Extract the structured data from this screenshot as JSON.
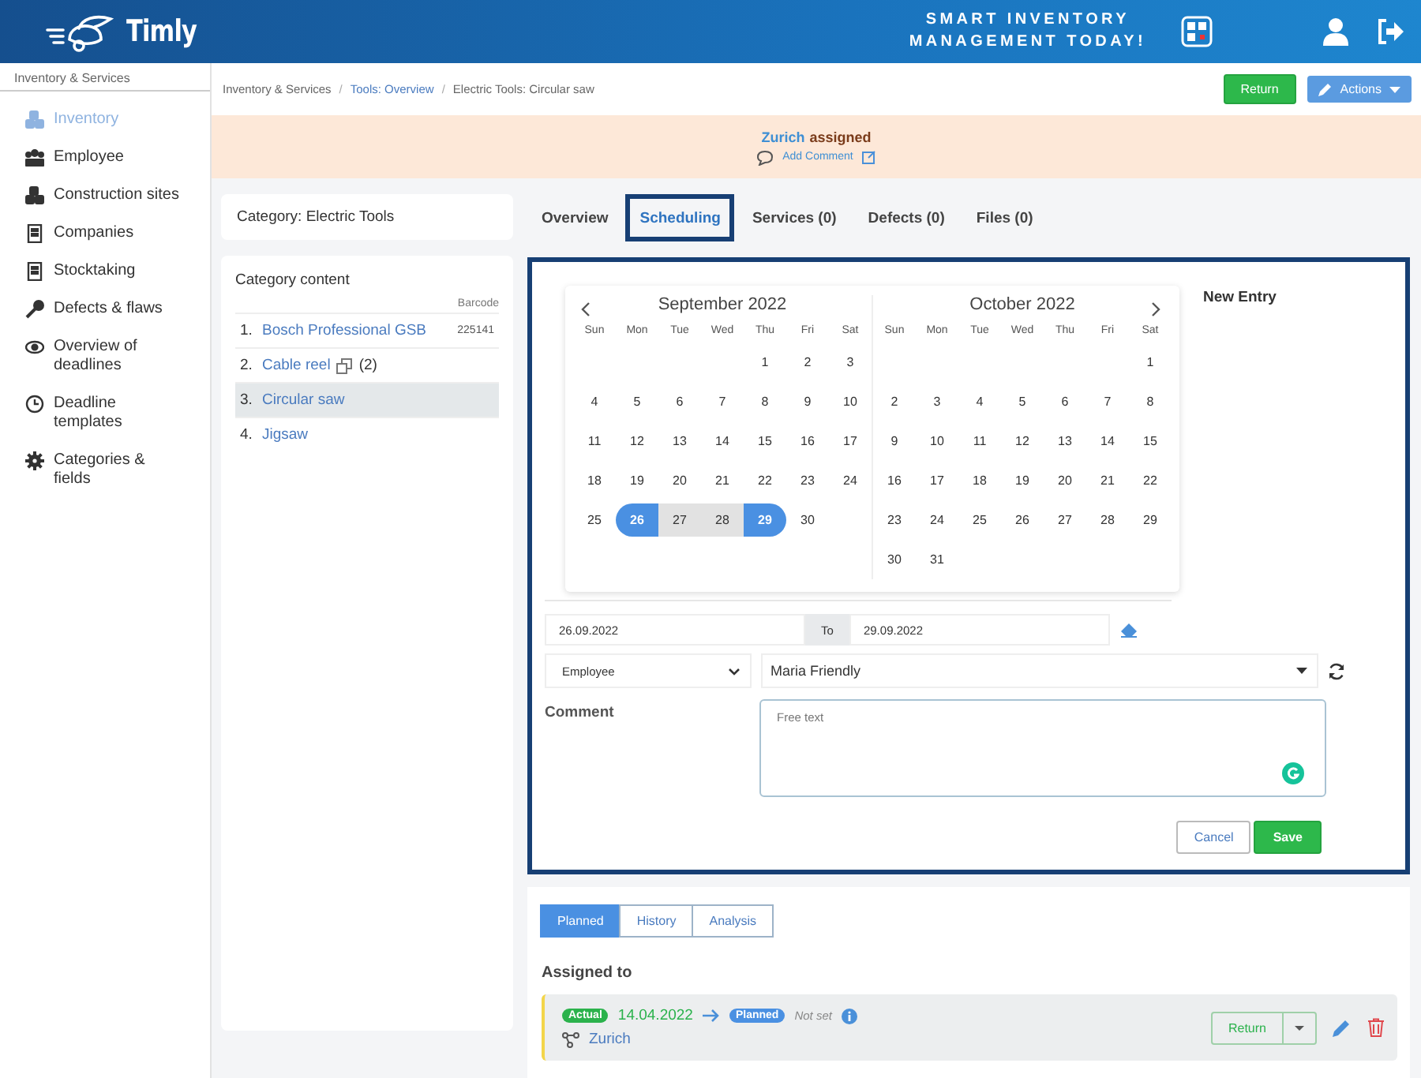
{
  "header": {
    "logo": "Timly",
    "slogan_lines": [
      "SMART INVENTORY",
      "MANAGEMENT TODAY!"
    ]
  },
  "sidebar": {
    "title": "Inventory & Services",
    "items": [
      {
        "label": "Inventory",
        "kind": "boxes",
        "selected": true
      },
      {
        "label": "Employee",
        "kind": "people",
        "selected": false
      },
      {
        "label": "Construction sites",
        "kind": "boxes",
        "selected": false
      },
      {
        "label": "Companies",
        "kind": "building",
        "selected": false
      },
      {
        "label": "Stocktaking",
        "kind": "building",
        "selected": false
      },
      {
        "label": "Defects & flaws",
        "kind": "wrench",
        "selected": false
      },
      {
        "label": "Overview of deadlines",
        "kind": "eye",
        "selected": false
      },
      {
        "label": "Deadline templates",
        "kind": "clock",
        "selected": false
      },
      {
        "label": "Categories & fields",
        "kind": "gear",
        "selected": false
      }
    ]
  },
  "breadcrumb": [
    {
      "label": "Inventory & Services",
      "kind": "text"
    },
    {
      "separator": "/",
      "label": "Tools: Overview",
      "kind": "link"
    },
    {
      "separator": "/",
      "label": "Electric Tools: Circular saw",
      "kind": "text"
    }
  ],
  "top_actions": {
    "return": "Return",
    "actions": "Actions"
  },
  "banner": {
    "location": "Zurich",
    "status": "assigned",
    "comment_link": "Add Comment"
  },
  "category": {
    "title": "Category: Electric Tools",
    "content_title": "Category content",
    "barcode_header": "Barcode",
    "items": [
      {
        "number": "1.",
        "name": "Bosch Professional GSB",
        "barcode": "225141",
        "selected": false
      },
      {
        "number": "2.",
        "name": "Cable reel",
        "count": "(2)",
        "selected": false
      },
      {
        "number": "3.",
        "name": "Circular saw",
        "selected": true
      },
      {
        "number": "4.",
        "name": "Jigsaw",
        "selected": false
      }
    ]
  },
  "tabs": [
    {
      "label": "Overview",
      "selected": false
    },
    {
      "label": "Scheduling",
      "selected": true
    },
    {
      "label": "Services (0)",
      "selected": false
    },
    {
      "label": "Defects (0)",
      "selected": false
    },
    {
      "label": "Files (0)",
      "selected": false
    }
  ],
  "scheduling": {
    "calendar": {
      "months": [
        {
          "title": "September 2022",
          "weekdays": [
            "Sun",
            "Mon",
            "Tue",
            "Wed",
            "Thu",
            "Fri",
            "Sat"
          ],
          "weeks": [
            {
              "right_aligned": true,
              "days": [
                {
                  "day": "1",
                  "selected": false,
                  "in_range": false
                },
                {
                  "day": "2",
                  "selected": false,
                  "in_range": false
                },
                {
                  "day": "3",
                  "selected": false,
                  "in_range": false
                }
              ]
            },
            {
              "days": [
                {
                  "day": "4",
                  "selected": false,
                  "in_range": false
                },
                {
                  "day": "5",
                  "selected": false,
                  "in_range": false
                },
                {
                  "day": "6",
                  "selected": false,
                  "in_range": false
                },
                {
                  "day": "7",
                  "selected": false,
                  "in_range": false
                },
                {
                  "day": "8",
                  "selected": false,
                  "in_range": false
                },
                {
                  "day": "9",
                  "selected": false,
                  "in_range": false
                },
                {
                  "day": "10",
                  "selected": false,
                  "in_range": false
                }
              ]
            },
            {
              "days": [
                {
                  "day": "11",
                  "selected": false,
                  "in_range": false
                },
                {
                  "day": "12",
                  "selected": false,
                  "in_range": false
                },
                {
                  "day": "13",
                  "selected": false,
                  "in_range": false
                },
                {
                  "day": "14",
                  "selected": false,
                  "in_range": false
                },
                {
                  "day": "15",
                  "selected": false,
                  "in_range": false
                },
                {
                  "day": "16",
                  "selected": false,
                  "in_range": false
                },
                {
                  "day": "17",
                  "selected": false,
                  "in_range": false
                }
              ]
            },
            {
              "days": [
                {
                  "day": "18",
                  "selected": false,
                  "in_range": false
                },
                {
                  "day": "19",
                  "selected": false,
                  "in_range": false
                },
                {
                  "day": "20",
                  "selected": false,
                  "in_range": false
                },
                {
                  "day": "21",
                  "selected": false,
                  "in_range": false
                },
                {
                  "day": "22",
                  "selected": false,
                  "in_range": false
                },
                {
                  "day": "23",
                  "selected": false,
                  "in_range": false
                },
                {
                  "day": "24",
                  "selected": false,
                  "in_range": false
                }
              ]
            },
            {
              "right_aligned": false,
              "days": [
                {
                  "day": "25",
                  "selected": false,
                  "in_range": false
                },
                {
                  "day": "26",
                  "selected": true,
                  "in_range": true
                },
                {
                  "day": "27",
                  "selected": false,
                  "in_range": true
                },
                {
                  "day": "28",
                  "selected": false,
                  "in_range": true
                },
                {
                  "day": "29",
                  "selected": true,
                  "in_range": true
                },
                {
                  "day": "30",
                  "selected": false,
                  "in_range": false
                }
              ]
            }
          ]
        },
        {
          "title": "October 2022",
          "weekdays": [
            "Sun",
            "Mon",
            "Tue",
            "Wed",
            "Thu",
            "Fri",
            "Sat"
          ],
          "weeks": [
            {
              "right_aligned": true,
              "days": [
                {
                  "day": "1",
                  "selected": false,
                  "in_range": false
                }
              ]
            },
            {
              "days": [
                {
                  "day": "2",
                  "selected": false,
                  "in_range": false
                },
                {
                  "day": "3",
                  "selected": false,
                  "in_range": false
                },
                {
                  "day": "4",
                  "selected": false,
                  "in_range": false
                },
                {
                  "day": "5",
                  "selected": false,
                  "in_range": false
                },
                {
                  "day": "6",
                  "selected": false,
                  "in_range": false
                },
                {
                  "day": "7",
                  "selected": false,
                  "in_range": false
                },
                {
                  "day": "8",
                  "selected": false,
                  "in_range": false
                }
              ]
            },
            {
              "days": [
                {
                  "day": "9",
                  "selected": false,
                  "in_range": false
                },
                {
                  "day": "10",
                  "selected": false,
                  "in_range": false
                },
                {
                  "day": "11",
                  "selected": false,
                  "in_range": false
                },
                {
                  "day": "12",
                  "selected": false,
                  "in_range": false
                },
                {
                  "day": "13",
                  "selected": false,
                  "in_range": false
                },
                {
                  "day": "14",
                  "selected": false,
                  "in_range": false
                },
                {
                  "day": "15",
                  "selected": false,
                  "in_range": false
                }
              ]
            },
            {
              "days": [
                {
                  "day": "16",
                  "selected": false,
                  "in_range": false
                },
                {
                  "day": "17",
                  "selected": false,
                  "in_range": false
                },
                {
                  "day": "18",
                  "selected": false,
                  "in_range": false
                },
                {
                  "day": "19",
                  "selected": false,
                  "in_range": false
                },
                {
                  "day": "20",
                  "selected": false,
                  "in_range": false
                },
                {
                  "day": "21",
                  "selected": false,
                  "in_range": false
                },
                {
                  "day": "22",
                  "selected": false,
                  "in_range": false
                }
              ]
            },
            {
              "days": [
                {
                  "day": "23",
                  "selected": false,
                  "in_range": false
                },
                {
                  "day": "24",
                  "selected": false,
                  "in_range": false
                },
                {
                  "day": "25",
                  "selected": false,
                  "in_range": false
                },
                {
                  "day": "26",
                  "selected": false,
                  "in_range": false
                },
                {
                  "day": "27",
                  "selected": false,
                  "in_range": false
                },
                {
                  "day": "28",
                  "selected": false,
                  "in_range": false
                },
                {
                  "day": "29",
                  "selected": false,
                  "in_range": false
                }
              ]
            },
            {
              "right_aligned": false,
              "days": [
                {
                  "day": "30",
                  "selected": false,
                  "in_range": false
                },
                {
                  "day": "31",
                  "selected": false,
                  "in_range": false
                }
              ]
            }
          ]
        }
      ]
    },
    "new_entry_title": "New Entry",
    "date_from": "26.09.2022",
    "to_label": "To",
    "date_to": "29.09.2022",
    "type_select": "Employee",
    "person_select": "Maria Friendly",
    "comment_label": "Comment",
    "comment_placeholder": "Free text",
    "cancel": "Cancel",
    "save": "Save"
  },
  "assignments": {
    "views": [
      {
        "label": "Planned",
        "selected": true
      },
      {
        "label": "History",
        "selected": false
      },
      {
        "label": "Analysis",
        "selected": false
      }
    ],
    "title": "Assigned to",
    "entries": [
      {
        "actual_badge": "Actual",
        "actual_date": "14.04.2022",
        "planned_badge": "Planned",
        "planned_date": "Not set",
        "location": "Zurich",
        "return": "Return"
      }
    ]
  }
}
